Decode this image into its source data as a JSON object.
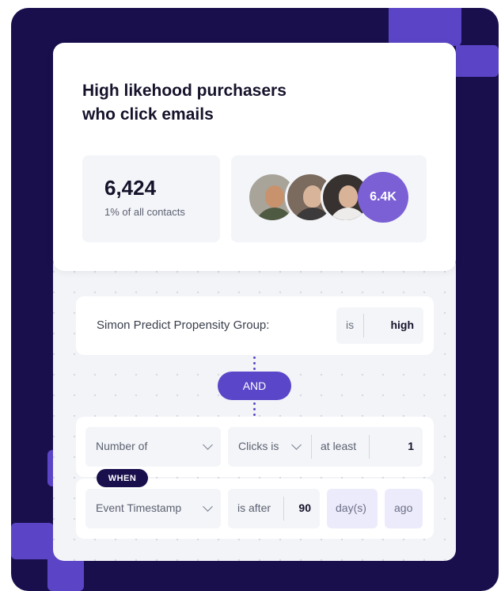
{
  "header": {
    "title_line1": "High likehood purchasers",
    "title_line2": "who click emails"
  },
  "stats": {
    "count": "6,424",
    "subtitle": "1% of all contacts"
  },
  "avatars": {
    "items": [
      {
        "name": "avatar-person-1"
      },
      {
        "name": "avatar-person-2"
      },
      {
        "name": "avatar-person-3"
      }
    ],
    "more_count": "6.4K"
  },
  "condition1": {
    "label": "Simon Predict Propensity Group:",
    "operator": "is",
    "value": "high"
  },
  "connector": {
    "label": "AND"
  },
  "condition2": {
    "field": "Number of",
    "metric": "Clicks is",
    "operator": "at least",
    "value": "1"
  },
  "when": {
    "badge": "WHEN",
    "field": "Event Timestamp",
    "operator": "is after",
    "value": "90",
    "unit": "day(s)",
    "suffix": "ago"
  },
  "colors": {
    "background": "#190f4d",
    "accent": "#5a46c8",
    "badge": "#7a5fd5"
  }
}
